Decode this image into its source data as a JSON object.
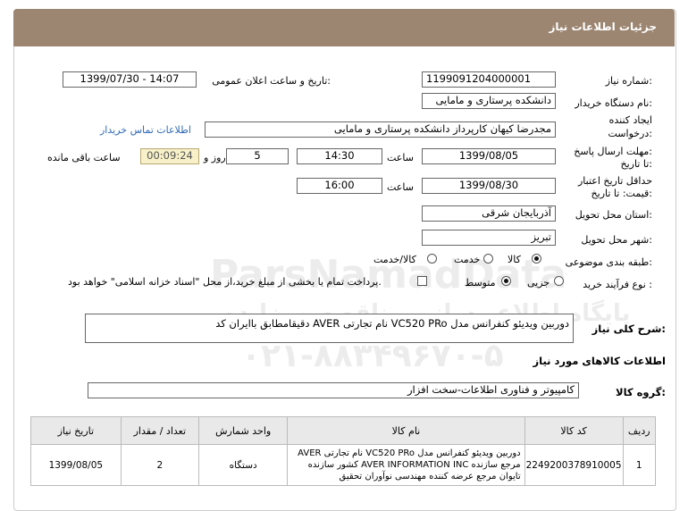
{
  "header": {
    "title": "جزئیات اطلاعات نیاز"
  },
  "labels": {
    "need_number": "شماره نیاز:",
    "announce_datetime": "تاریخ و ساعت اعلان عمومی:",
    "buyer_org": "نام دستگاه خریدار:",
    "creator_line1": "ایجاد کننده",
    "creator_line2": "درخواست:",
    "reply_deadline_line1": "مهلت ارسال پاسخ:",
    "reply_deadline_line2": "تا تاریخ:",
    "time": "ساعت",
    "day_and": "روز و",
    "remaining": "ساعت باقی مانده",
    "validity_line1": "حداقل تاریخ اعتبار",
    "validity_line2": "قیمت: تا تاریخ:",
    "delivery_province": "استان محل تحویل:",
    "delivery_city": "شهر محل تحویل:",
    "category": "طبقه بندی موضوعی:",
    "process_type": "نوع فرآیند خرید :",
    "general_desc": "شرح کلی نیاز:",
    "goods_info": "اطلاعات کالاهای مورد نیاز",
    "goods_group": "گروه کالا:"
  },
  "values": {
    "need_number": "1199091204000001",
    "announce_datetime": "1399/07/30 - 14:07",
    "buyer_org": "دانشکده پرستاری و مامایی",
    "creator": "مجدرضا کیهان کارپرداز دانشکده پرستاری و مامایی",
    "contact_link": "اطلاعات تماس خریدار",
    "reply_date": "1399/08/05",
    "reply_time": "14:30",
    "reply_days": "5",
    "remaining_time": "00:09:24",
    "validity_date": "1399/08/30",
    "validity_time": "16:00",
    "province": "آذربایجان شرقی",
    "city": "تبریز",
    "general_desc": "دوربین ویدیئو کنفرانس مدل VC520 PRo نام تجارتی AVER دقیقامطابق باایران کد",
    "goods_group": "کامپیوتر و فناوری اطلاعات-سخت افزار"
  },
  "category_options": [
    {
      "label": "کالا",
      "selected": true
    },
    {
      "label": "خدمت",
      "selected": false
    },
    {
      "label": "کالا/خدمت",
      "selected": false
    }
  ],
  "process_options": [
    {
      "label": "جزیی",
      "selected": false
    },
    {
      "label": "متوسط",
      "selected": true
    }
  ],
  "payment_note": "پرداخت تمام یا بخشی از مبلغ خرید،از محل \"اسناد خزانه اسلامی\" خواهد بود.",
  "watermark": {
    "line1": "ParsNamadData",
    "line2": "پایگاه اطلاع رسانی مناقصه ومزایده",
    "line3": "۰۲۱-۸۸۳۴۹۶۷۰-۵"
  },
  "table": {
    "headers": [
      "ردیف",
      "کد کالا",
      "نام کالا",
      "واحد شمارش",
      "تعداد / مقدار",
      "تاریخ نیاز"
    ],
    "rows": [
      {
        "row": "1",
        "code": "2249200378910005",
        "name_line1": "دوربین ویدیئو کنفرانس مدل VC520 PRo نام تجارتی AVER",
        "name_line2": "مرجع سازنده AVER INFORMATION INC کشور سازنده",
        "name_line3": "تایوان مرجع عرضه کننده مهندسی نوآوران تحقیق",
        "unit": "دستگاه",
        "qty": "2",
        "date": "1399/08/05"
      }
    ]
  }
}
